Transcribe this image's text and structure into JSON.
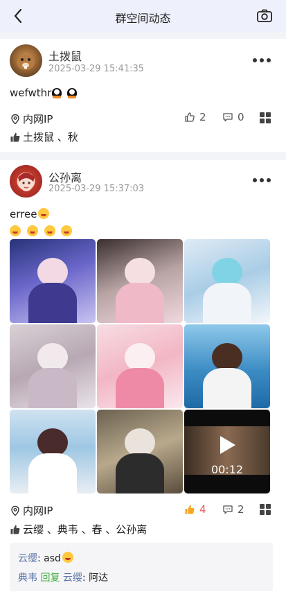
{
  "header": {
    "title": "群空间动态"
  },
  "posts": [
    {
      "user": "土拨鼠",
      "time": "2025-03-29 15:41:35",
      "text": "wefwthr",
      "location": "内网IP",
      "like_count": "2",
      "comment_count": "0",
      "likers": "土拨鼠 、秋"
    },
    {
      "user": "公孙离",
      "time": "2025-03-29 15:37:03",
      "text": "erree",
      "location": "内网IP",
      "like_count": "4",
      "comment_count": "2",
      "likers": "云缨 、典韦 、春 、公孙离",
      "video_duration": "00:12",
      "comments": [
        {
          "author": "云缨",
          "sep": ": ",
          "text": "asd"
        },
        {
          "author": "典韦",
          "reply_word": "回复",
          "target": "云缨",
          "sep": ": ",
          "text": "阿达"
        }
      ]
    }
  ],
  "colors": {
    "accent_like": "#f5a623",
    "like_count_active": "#e55",
    "name_link": "#5a74a8",
    "reply_word": "#3fae3f",
    "header_bg": "#eef1fb"
  }
}
